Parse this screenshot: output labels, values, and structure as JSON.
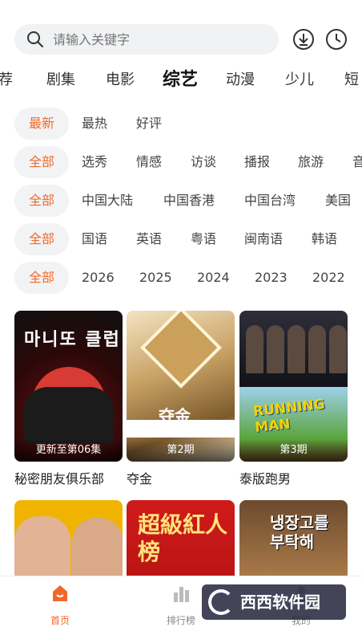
{
  "search": {
    "placeholder": "请输入关键字"
  },
  "categories": [
    "荐",
    "剧集",
    "电影",
    "综艺",
    "动漫",
    "少儿",
    "短"
  ],
  "active_category": "综艺",
  "filters": {
    "sort": [
      "最新",
      "最热",
      "好评"
    ],
    "type": [
      "全部",
      "选秀",
      "情感",
      "访谈",
      "播报",
      "旅游",
      "音"
    ],
    "region": [
      "全部",
      "中国大陆",
      "中国香港",
      "中国台湾",
      "美国"
    ],
    "language": [
      "全部",
      "国语",
      "英语",
      "粤语",
      "闽南语",
      "韩语"
    ],
    "year": [
      "全部",
      "2026",
      "2025",
      "2024",
      "2023",
      "2022"
    ]
  },
  "cards": [
    {
      "title": "秘密朋友俱乐部",
      "label": "更新至第06集",
      "poster_text": "마니또 클럽"
    },
    {
      "title": "夺金",
      "label": "第2期",
      "poster_text": "夺金"
    },
    {
      "title": "泰版跑男",
      "label": "第3期",
      "poster_text": "RUNNING MAN"
    },
    {
      "title": "",
      "label": "",
      "poster_text": ""
    },
    {
      "title": "",
      "label": "",
      "poster_text": "超級紅人榜"
    },
    {
      "title": "",
      "label": "",
      "poster_text": "냉장고를 부탁해"
    }
  ],
  "bottom_nav": [
    {
      "label": "首页",
      "icon": "home-icon"
    },
    {
      "label": "排行榜",
      "icon": "ranking-icon"
    },
    {
      "label": "我的",
      "icon": "profile-icon"
    }
  ],
  "watermark": {
    "text": "西西软件园"
  },
  "colors": {
    "accent": "#ef6a2a",
    "chip_bg": "#f2f3f5"
  }
}
